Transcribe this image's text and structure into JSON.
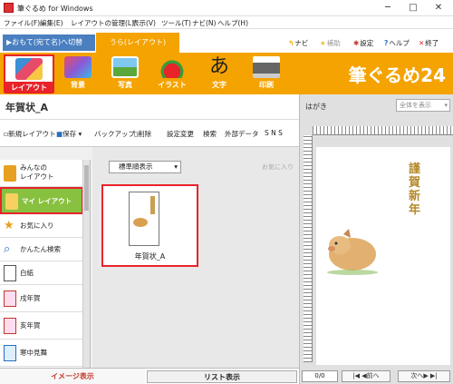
{
  "window": {
    "title": "筆ぐるめ for Windows",
    "controls": [
      "─",
      "□",
      "✕"
    ]
  },
  "menu": [
    "ファイル(F)",
    "編集(E)",
    "レイアウトの管理(L)",
    "表示(V)",
    "ツール(T)",
    "ナビ(N)",
    "ヘルプ(H)"
  ],
  "tabs": {
    "front": "▶おもて(宛て名)へ切替",
    "back": "うら(レイアウト)"
  },
  "header_buttons": {
    "navi": "ナビ",
    "assist": "補助",
    "settings": "設定",
    "help": "ヘルプ",
    "exit": "終了"
  },
  "toolbar": {
    "layout": "レイアウト",
    "background": "背景",
    "photo": "写真",
    "illust": "イラスト",
    "text": "文字",
    "print": "印刷",
    "brand": "筆ぐるめ24"
  },
  "doc": {
    "title": "年賀状_A"
  },
  "actions": {
    "new_layout": "新規レイアウト",
    "save": "保存",
    "backup": "バックアップ",
    "delete": "削除",
    "change_settings": "設定変更",
    "search": "検索",
    "external_data": "外部データ",
    "sns": "S N S"
  },
  "sidebar": {
    "items": [
      {
        "label": "みんなの\nレイアウト"
      },
      {
        "label": "マイ レイアウト"
      },
      {
        "label": "お気に入り"
      },
      {
        "label": "かんたん検索"
      },
      {
        "label": "白紙"
      },
      {
        "label": "戌年賀"
      },
      {
        "label": "亥年賀"
      },
      {
        "label": "寒中見舞"
      }
    ]
  },
  "gallery": {
    "sort": "標準順表示",
    "fav_hint": "お気に入り",
    "thumb_caption": "年賀状_A"
  },
  "bottom_tabs": {
    "image": "イメージ表示",
    "list": "リスト表示"
  },
  "preview": {
    "label": "はがき",
    "zoom": "全体を表示",
    "greeting": "謹賀新年",
    "page": "0/0",
    "prev": "前へ",
    "next": "次へ"
  },
  "colors": {
    "accent_orange": "#f4a300",
    "highlight_red": "#e8232a",
    "tab_blue": "#4a7fc0",
    "selected_green": "#88c040"
  }
}
